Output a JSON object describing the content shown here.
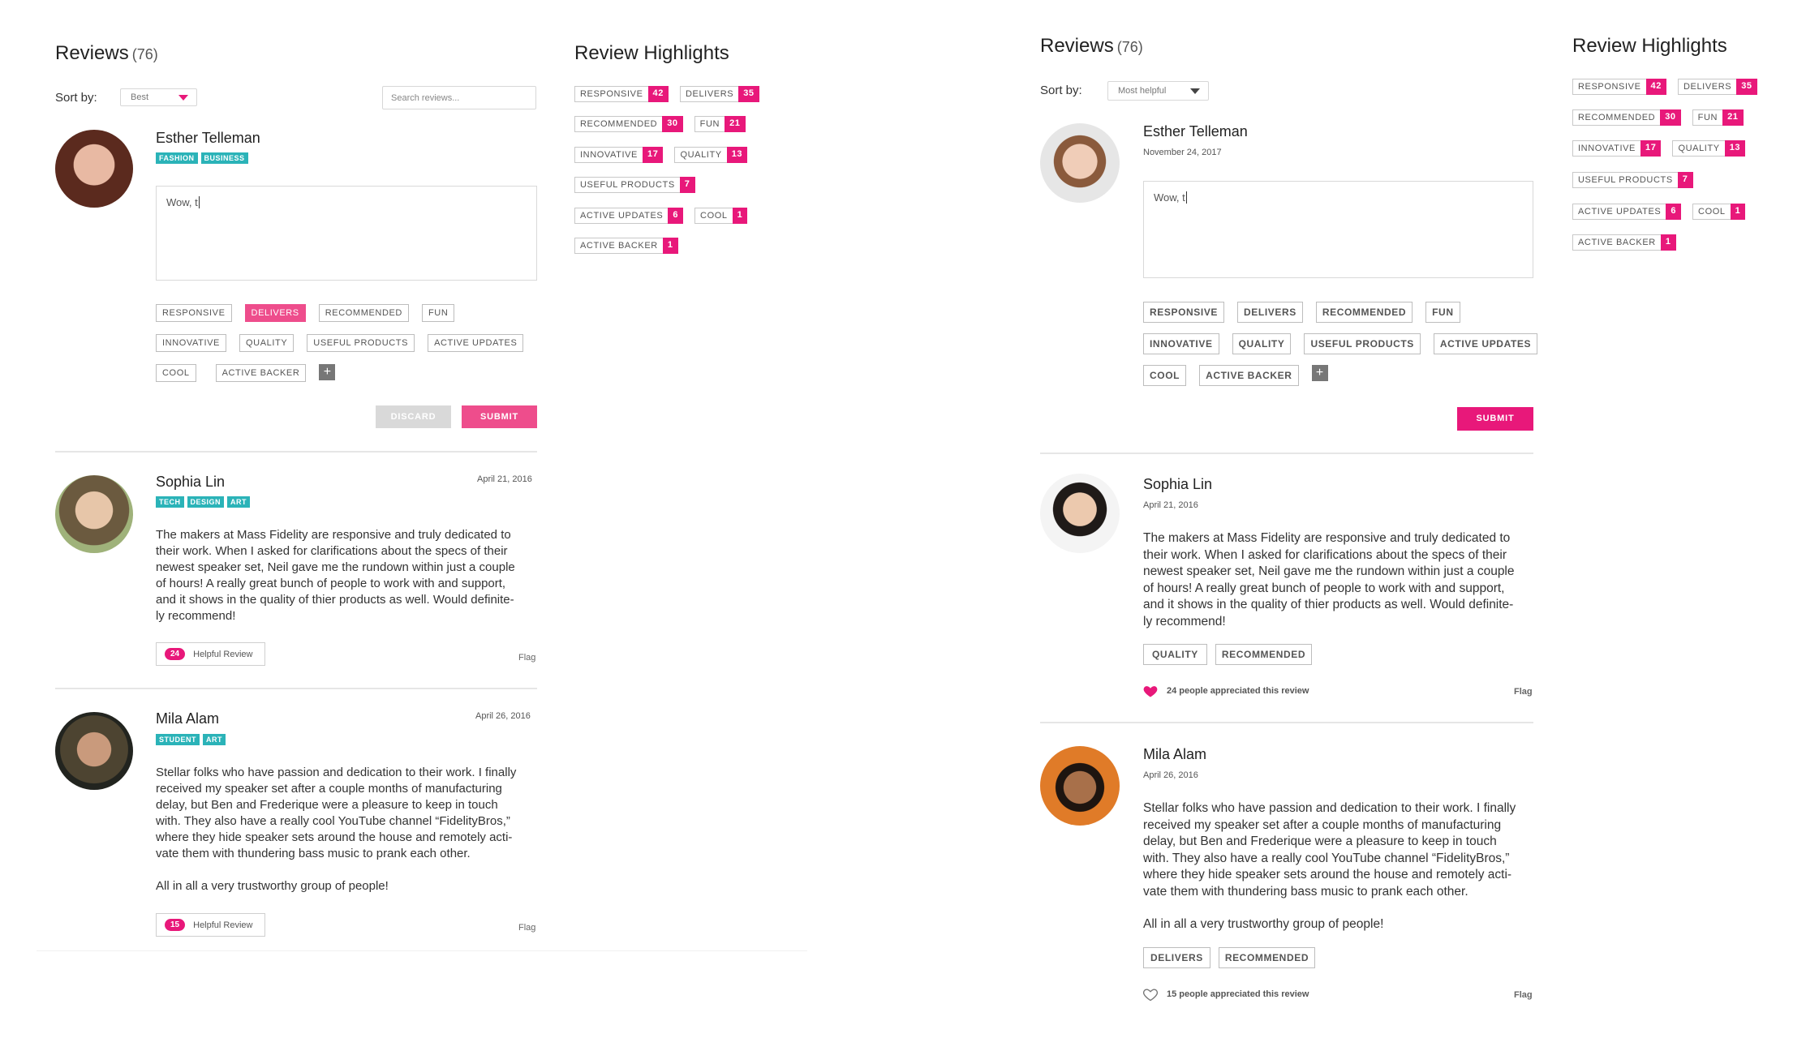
{
  "left": {
    "reviews_title": "Reviews",
    "reviews_count": "(76)",
    "sort_label": "Sort by:",
    "sort_value": "Best",
    "search_placeholder": "Search reviews...",
    "highlights_title": "Review Highlights",
    "compose": {
      "name": "Esther Telleman",
      "badges": [
        "FASHION",
        "BUSINESS"
      ],
      "text": "Wow, t",
      "tags": [
        "RESPONSIVE",
        "DELIVERS",
        "RECOMMENDED",
        "FUN",
        "INNOVATIVE",
        "QUALITY",
        "USEFUL PRODUCTS",
        "ACTIVE UPDATES",
        "COOL",
        "ACTIVE BACKER"
      ],
      "plus": "+",
      "discard": "DISCARD",
      "submit": "SUBMIT"
    },
    "reviews": [
      {
        "name": "Sophia Lin",
        "date": "April 21, 2016",
        "badges": [
          "TECH",
          "DESIGN",
          "ART"
        ],
        "lines": [
          "The makers at Mass Fidelity are responsive and truly dedicated to",
          "their work. When I asked for clarifications about the specs of their",
          "newest speaker set, Neil gave me the rundown within just a couple",
          "of hours! A really great bunch of people to work with and support,",
          "and it shows in the quality of thier products as well. Would definite-",
          "ly recommend!"
        ],
        "helpful_count": "24",
        "helpful_label": "Helpful Review",
        "flag": "Flag"
      },
      {
        "name": "Mila Alam",
        "date": "April 26, 2016",
        "badges": [
          "STUDENT",
          "ART"
        ],
        "lines": [
          "Stellar folks who have passion and dedication to their work. I finally",
          "received my speaker set after a couple months of manufacturing",
          "delay, but Ben and Frederique were a pleasure to keep in touch",
          "with. They also have a really cool YouTube channel “FidelityBros,”",
          "where they hide speaker sets around the house and remotely acti-",
          "vate them with thundering bass music to prank each other.",
          "",
          "All in all a very trustworthy group of people!"
        ],
        "helpful_count": "15",
        "helpful_label": "Helpful Review",
        "flag": "Flag"
      }
    ],
    "highlights": [
      [
        {
          "label": "RESPONSIVE",
          "count": "42"
        },
        {
          "label": "DELIVERS",
          "count": "35"
        }
      ],
      [
        {
          "label": "RECOMMENDED",
          "count": "30"
        },
        {
          "label": "FUN",
          "count": "21"
        }
      ],
      [
        {
          "label": "INNOVATIVE",
          "count": "17"
        },
        {
          "label": "QUALITY",
          "count": "13"
        }
      ],
      [
        {
          "label": "USEFUL PRODUCTS",
          "count": "7"
        }
      ],
      [
        {
          "label": "ACTIVE UPDATES",
          "count": "6"
        },
        {
          "label": "COOL",
          "count": "1"
        }
      ],
      [
        {
          "label": "ACTIVE BACKER",
          "count": "1"
        }
      ]
    ]
  },
  "right": {
    "reviews_title": "Reviews",
    "reviews_count": "(76)",
    "sort_label": "Sort by:",
    "sort_value": "Most helpful",
    "highlights_title": "Review Highlights",
    "compose": {
      "name": "Esther Telleman",
      "date": "November 24, 2017",
      "text": "Wow, t",
      "tags": [
        "RESPONSIVE",
        "DELIVERS",
        "RECOMMENDED",
        "FUN",
        "INNOVATIVE",
        "QUALITY",
        "USEFUL PRODUCTS",
        "ACTIVE UPDATES",
        "COOL",
        "ACTIVE BACKER"
      ],
      "plus": "+",
      "submit": "SUBMIT"
    },
    "reviews": [
      {
        "name": "Sophia Lin",
        "date": "April 21, 2016",
        "lines": [
          "The makers at Mass Fidelity are responsive and truly dedicated to",
          "their work. When I asked for clarifications about the specs of their",
          "newest speaker set, Neil gave me the rundown within just a couple",
          "of hours! A really great bunch of people to work with and support,",
          "and it shows in the quality of thier products as well. Would definite-",
          "ly recommend!"
        ],
        "tags": [
          "QUALITY",
          "RECOMMENDED"
        ],
        "appreciated": "24 people appreciated this review",
        "liked": true,
        "flag": "Flag"
      },
      {
        "name": "Mila Alam",
        "date": "April 26, 2016",
        "lines": [
          "Stellar folks who have passion and dedication to their work. I finally",
          "received my speaker set after a couple months of manufacturing",
          "delay, but Ben and Frederique were a pleasure to keep in touch",
          "with. They also have a really cool YouTube channel “FidelityBros,”",
          "where they hide speaker sets around the house and remotely acti-",
          "vate them with thundering bass music to prank each other.",
          "",
          "All in all a very trustworthy group of people!"
        ],
        "tags": [
          "DELIVERS",
          "RECOMMENDED"
        ],
        "appreciated": "15 people appreciated this review",
        "liked": false,
        "flag": "Flag"
      }
    ],
    "highlights": [
      [
        {
          "label": "RESPONSIVE",
          "count": "42"
        },
        {
          "label": "DELIVERS",
          "count": "35"
        }
      ],
      [
        {
          "label": "RECOMMENDED",
          "count": "30"
        },
        {
          "label": "FUN",
          "count": "21"
        }
      ],
      [
        {
          "label": "INNOVATIVE",
          "count": "17"
        },
        {
          "label": "QUALITY",
          "count": "13"
        }
      ],
      [
        {
          "label": "USEFUL PRODUCTS",
          "count": "7"
        }
      ],
      [
        {
          "label": "ACTIVE UPDATES",
          "count": "6"
        },
        {
          "label": "COOL",
          "count": "1"
        }
      ],
      [
        {
          "label": "ACTIVE BACKER",
          "count": "1"
        }
      ]
    ]
  },
  "colors": {
    "accent_pink": "#e8187a",
    "tag_active": "#ee4d8c",
    "badge_teal": "#2bb3b8"
  }
}
